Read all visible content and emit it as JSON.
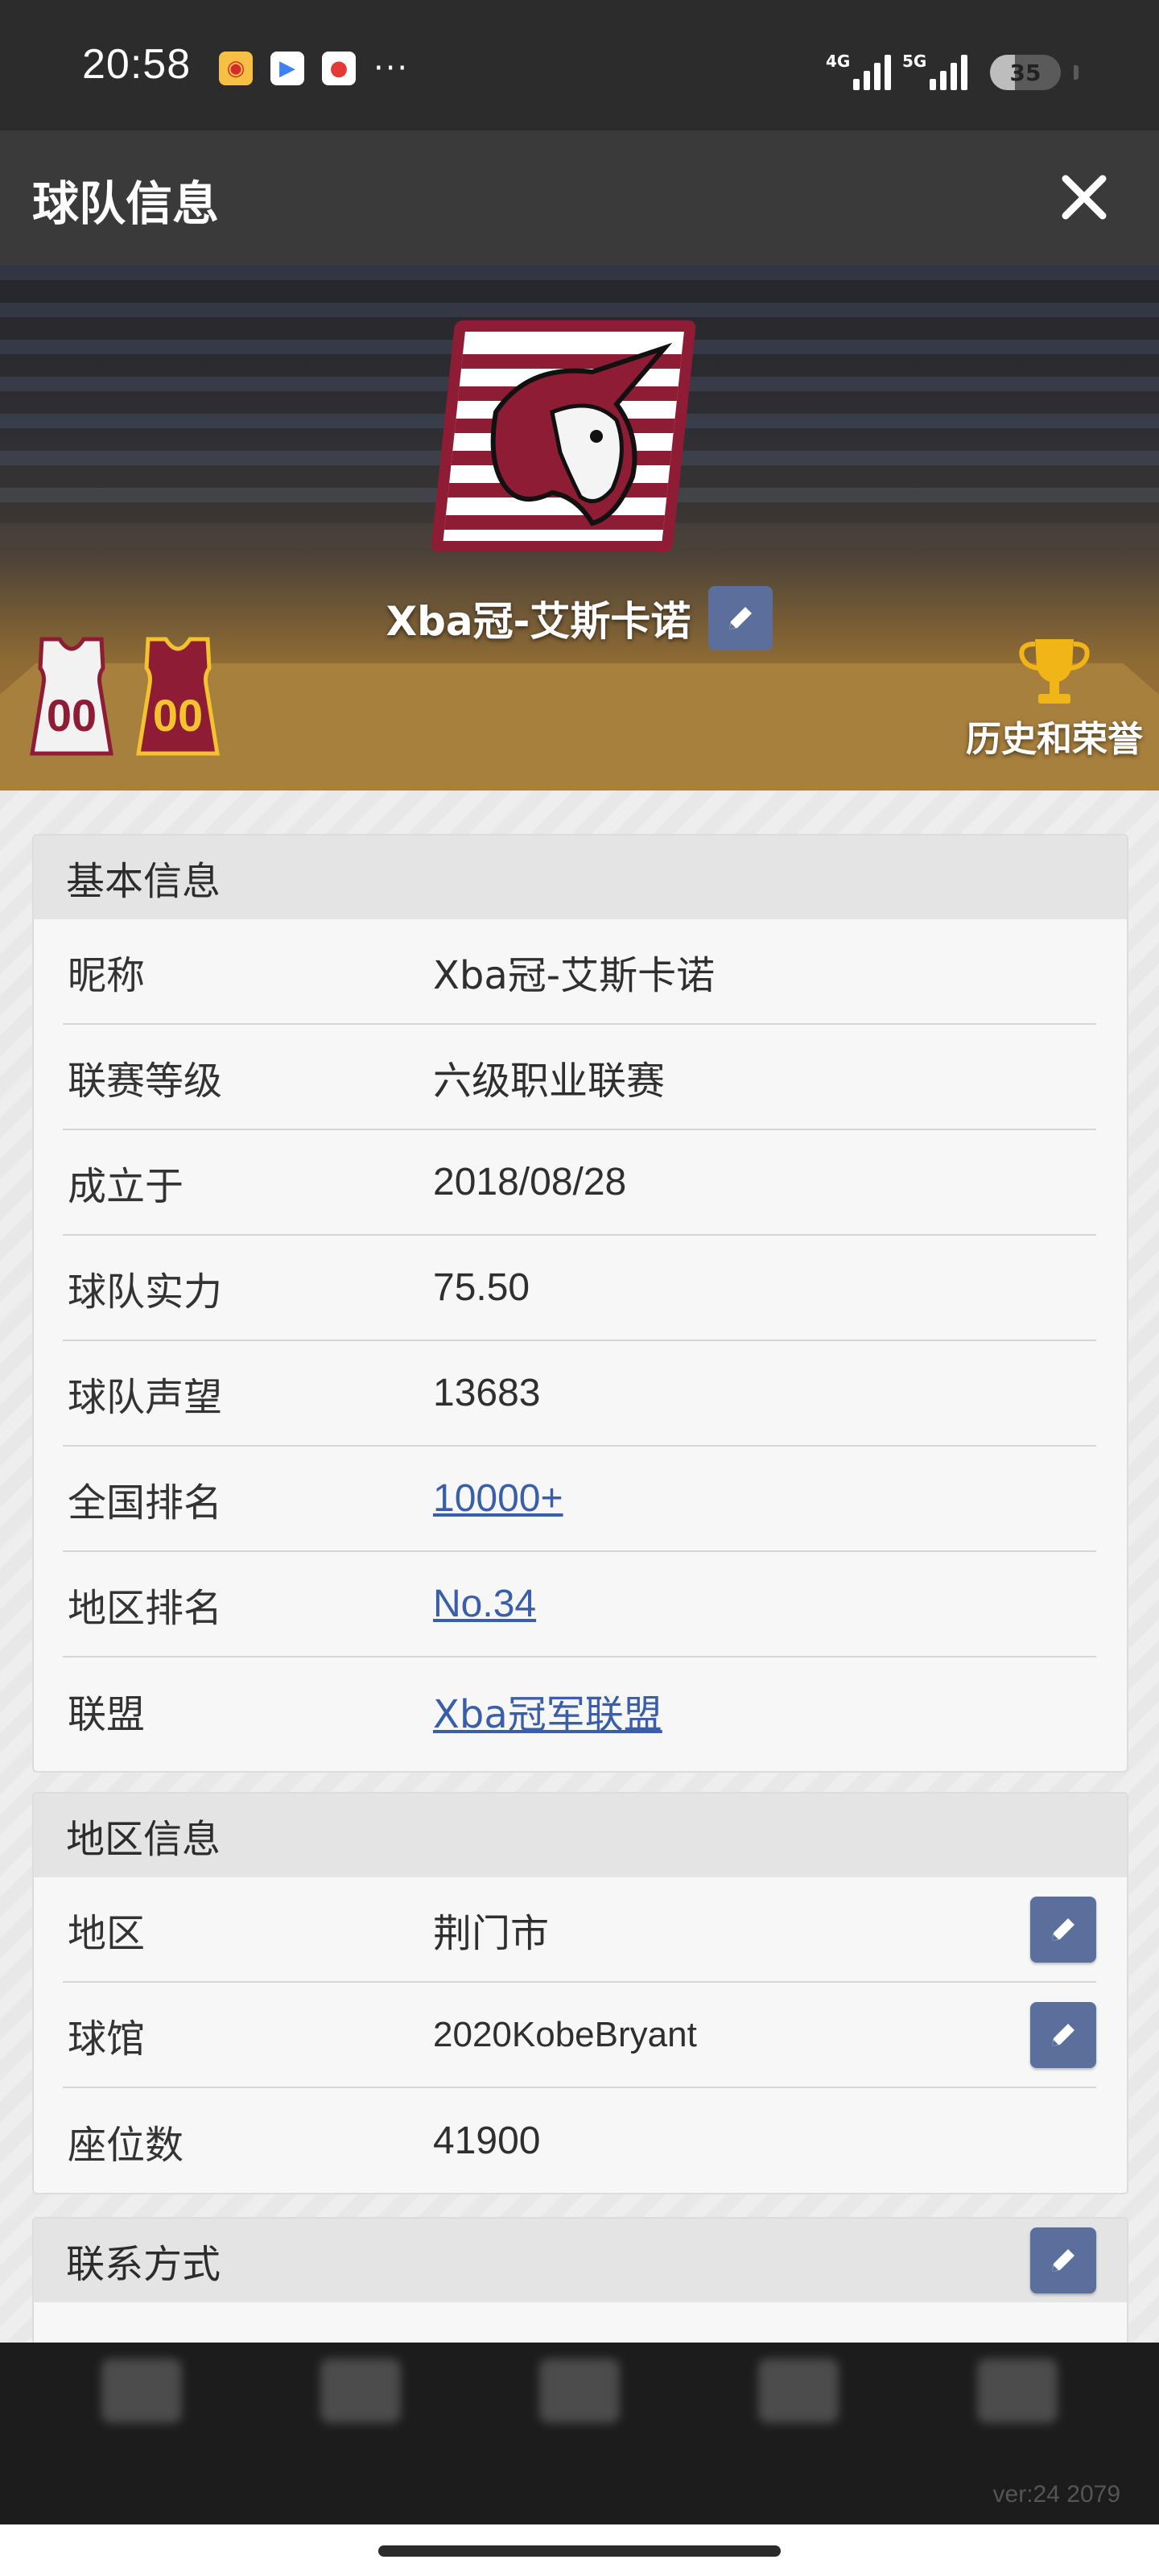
{
  "status_bar": {
    "time": "20:58",
    "more": "···",
    "network1": "4G",
    "network2": "5G",
    "battery_level": "35",
    "battery_fraction": 0.35,
    "notification_icons": [
      "weibo-icon",
      "play-store-icon",
      "maps-icon"
    ]
  },
  "header": {
    "title": "球队信息",
    "close_icon": "close-icon"
  },
  "hero": {
    "team_name": "Xba冠-艾斯卡诺",
    "jersey_home_number": "00",
    "jersey_away_number": "00",
    "honors_label": "历史和荣誉",
    "colors": {
      "home_jersey": "#f2f2f2",
      "away_jersey": "#8e1c34",
      "number_trim": "#f2c230",
      "logo_red": "#8e1c34"
    }
  },
  "basic_info": {
    "title": "基本信息",
    "rows": [
      {
        "label": "昵称",
        "value": "Xba冠-艾斯卡诺"
      },
      {
        "label": "联赛等级",
        "value": "六级职业联赛"
      },
      {
        "label": "成立于",
        "value": "2018/08/28"
      },
      {
        "label": "球队实力",
        "value": "75.50"
      },
      {
        "label": "球队声望",
        "value": "13683"
      },
      {
        "label": "全国排名",
        "value": "10000+"
      },
      {
        "label": "地区排名",
        "value": "No.34"
      },
      {
        "label": "联盟",
        "value": "Xba冠军联盟"
      }
    ]
  },
  "region_info": {
    "title": "地区信息",
    "rows": [
      {
        "label": "地区",
        "value": "荆门市"
      },
      {
        "label": "球馆",
        "value": "2020KobeBryant"
      },
      {
        "label": "座位数",
        "value": "41900"
      }
    ]
  },
  "contact": {
    "title": "联系方式"
  },
  "footer": {
    "version": "ver:24  2079"
  },
  "accent_colors": {
    "edit_button": "#5b6f9d",
    "link": "#3a5eaa"
  }
}
